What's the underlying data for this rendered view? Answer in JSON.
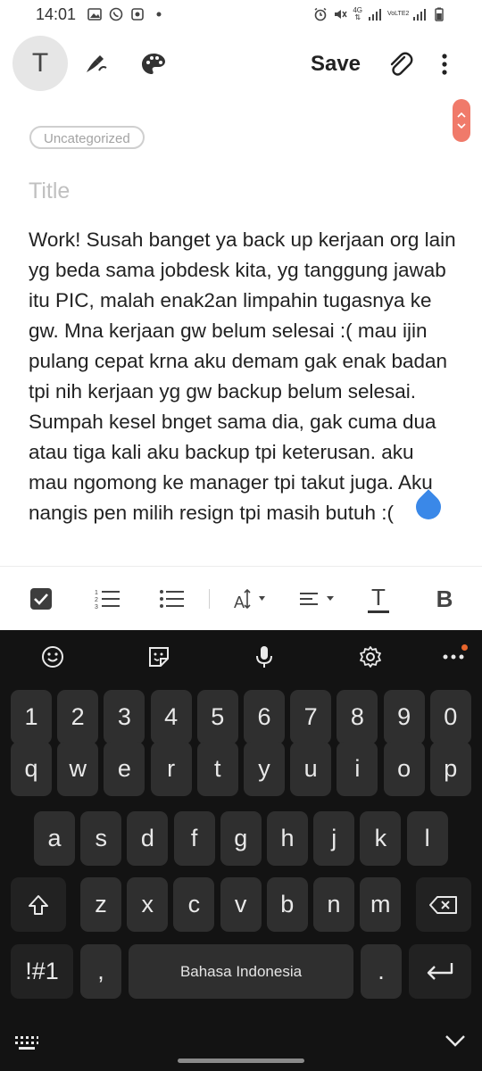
{
  "status_bar": {
    "time": "14:01",
    "network_4g": "4G",
    "network_volte": "VoLTE2"
  },
  "toolbar": {
    "text_mode_label": "T",
    "save_label": "Save"
  },
  "note": {
    "category": "Uncategorized",
    "title_placeholder": "Title",
    "body": "Work! Susah banget ya back up kerjaan org lain yg beda sama jobdesk kita, yg tanggung jawab itu PIC, malah enak2an limpahin tugasnya ke gw. Mna kerjaan gw belum selesai :( mau ijin pulang cepat krna aku demam gak enak badan tpi nih kerjaan yg gw backup belum selesai. Sumpah kesel bnget sama dia, gak cuma dua atau tiga kali aku backup tpi keterusan. aku mau ngomong ke manager tpi takut juga. Aku nangis pen milih resign tpi masih butuh :("
  },
  "format_bar": {
    "items": [
      "checkbox-icon",
      "numbered-list-icon",
      "bulleted-list-icon",
      "text-size-icon",
      "align-icon",
      "text-color-icon",
      "bold-icon"
    ],
    "bold_label": "B",
    "text_color_label": "T"
  },
  "keyboard": {
    "toolbar_icons": [
      "emoji-icon",
      "sticker-icon",
      "mic-icon",
      "settings-icon",
      "more-icon"
    ],
    "rows": [
      [
        "1",
        "2",
        "3",
        "4",
        "5",
        "6",
        "7",
        "8",
        "9",
        "0"
      ],
      [
        "q",
        "w",
        "e",
        "r",
        "t",
        "y",
        "u",
        "i",
        "o",
        "p"
      ],
      [
        "a",
        "s",
        "d",
        "f",
        "g",
        "h",
        "j",
        "k",
        "l"
      ],
      [
        "z",
        "x",
        "c",
        "v",
        "b",
        "n",
        "m"
      ]
    ],
    "symbols_label": "!#1",
    "comma_label": ",",
    "space_label": "Bahasa Indonesia",
    "period_label": ".",
    "accent_color": "#e8652c"
  },
  "colors": {
    "scroll_pill": "#f07a6a",
    "cursor_handle": "#3a88e8",
    "keyboard_bg": "#131313",
    "key_bg": "#2f2f2f"
  }
}
